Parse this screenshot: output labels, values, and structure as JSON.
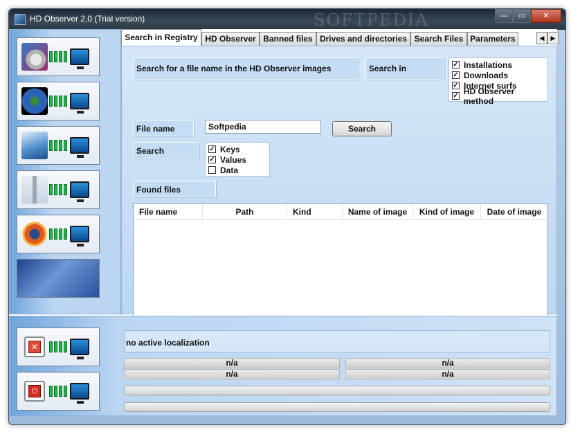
{
  "window": {
    "title": "HD Observer 2.0 (Trial version)",
    "watermark": "SOFTPEDIA",
    "controls": [
      "—",
      "▭",
      "✕"
    ]
  },
  "tabs": [
    {
      "label": "Search in Registry",
      "active": true
    },
    {
      "label": "HD Observer"
    },
    {
      "label": "Banned files"
    },
    {
      "label": "Drives and directories"
    },
    {
      "label": "Search Files"
    },
    {
      "label": "Parameters"
    }
  ],
  "tab_scroll": {
    "left": "◀",
    "right": "▶"
  },
  "registry": {
    "heading": "Search for a file name in the HD Observer images",
    "search_in_label": "Search in",
    "search_in_options": [
      {
        "label": "Installations",
        "checked": true
      },
      {
        "label": "Downloads",
        "checked": true
      },
      {
        "label": "Internet surfs",
        "checked": true
      },
      {
        "label": "HD Observer method",
        "checked": true
      }
    ],
    "file_name_label": "File name",
    "file_name_value": "Softpedia",
    "search_button": "Search",
    "search_label": "Search",
    "search_options": [
      {
        "label": "Keys",
        "checked": true
      },
      {
        "label": "Values",
        "checked": true
      },
      {
        "label": "Data",
        "checked": false
      }
    ],
    "found_files_label": "Found files",
    "columns": [
      "File name",
      "Path",
      "Kind",
      "Name of image",
      "Kind of image",
      "Date of image"
    ],
    "rows": []
  },
  "status": {
    "localization": "no active localization",
    "cells": [
      "n/a",
      "n/a",
      "n/a",
      "n/a"
    ]
  },
  "check_mark": "✓",
  "nav_icons": [
    "cd-install-icon",
    "globe-icon",
    "surf-icon",
    "antenna-icon",
    "explosion-icon",
    "hd-observer-logo-icon"
  ],
  "bottom_icons": [
    "stop-icon",
    "power-icon"
  ],
  "colors": {
    "bar_green": "#23b84a",
    "panel_blue": "#c4dcf4",
    "monitor_blue": "#2a8fdc"
  }
}
